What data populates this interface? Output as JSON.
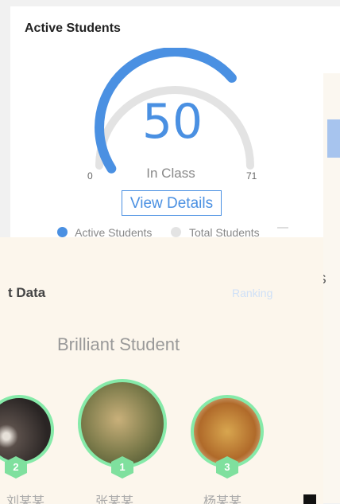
{
  "active_students_card": {
    "title": "Active Students",
    "value": "50",
    "sub_label": "In Class",
    "min_label": "0",
    "max_label": "71",
    "view_details_label": "View Details",
    "gauge_fraction": 0.7,
    "colors": {
      "active": "#4a90e2",
      "total": "#e3e3e3"
    },
    "legend": [
      {
        "label": "Active Students",
        "color": "#4a90e2"
      },
      {
        "label": "Total Students",
        "color": "#e3e3e3"
      }
    ]
  },
  "student_data_card": {
    "title": "t Data",
    "ranking_label": "Ranking",
    "section_heading": "Brilliant Student",
    "accent_color": "#86eaa9",
    "students": [
      {
        "rank": "1",
        "name": "张某某"
      },
      {
        "rank": "2",
        "name": "刘某某"
      },
      {
        "rank": "3",
        "name": "杨某某"
      }
    ]
  },
  "right_panel": {
    "partial_letter": "S"
  }
}
